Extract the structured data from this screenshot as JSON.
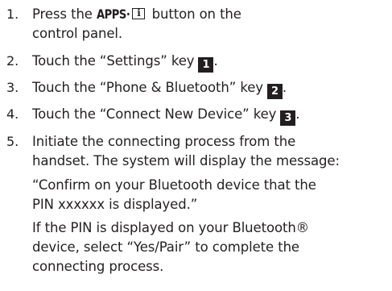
{
  "steps": [
    {
      "number": "1.",
      "pre": "Press the ",
      "button_label": "APPS·",
      "icon_glyph": "i",
      "post": " button on the",
      "line2": "control panel."
    },
    {
      "number": "2.",
      "text": "Touch the “Settings” key",
      "key": "1",
      "tail": "."
    },
    {
      "number": "3.",
      "text": "Touch the “Phone & Bluetooth” key",
      "key": "2",
      "tail": "."
    },
    {
      "number": "4.",
      "text": "Touch the “Connect New Device” key",
      "key": "3",
      "tail": "."
    },
    {
      "number": "5.",
      "lines": [
        "Initiate the connecting process from the",
        "handset. The system will display the message:",
        "“Confirm on your Bluetooth device that the",
        "PIN xxxxxx is displayed.”",
        "If the PIN is displayed on your Bluetooth®",
        "device, select “Yes/Pair” to complete the",
        "connecting process."
      ]
    }
  ],
  "colors": {
    "text": "#231f20",
    "badge_bg": "#231f20",
    "badge_text": "#ffffff"
  },
  "icons": {
    "info": "info-box-icon"
  }
}
